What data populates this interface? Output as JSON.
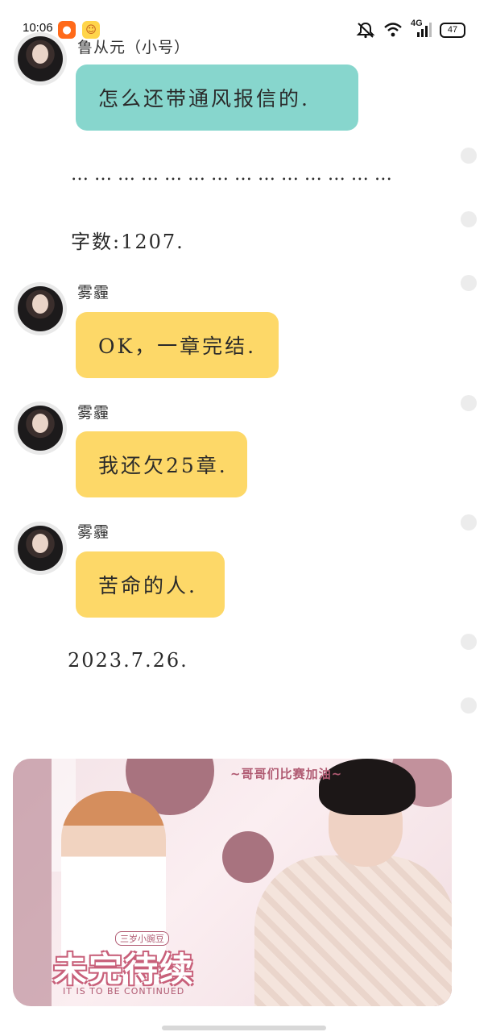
{
  "status_bar": {
    "time": "10:06",
    "network": "4G",
    "battery": "47",
    "icons": [
      "kuaishou-app-icon",
      "emoji-app-icon",
      "mute-icon",
      "wifi-icon",
      "signal-icon",
      "battery-icon"
    ]
  },
  "messages": [
    {
      "sender": "鲁从元（小号）",
      "text": "怎么还带通风报信的.",
      "bubble_color": "#87d6cd"
    },
    {
      "sender": "雾霾",
      "text": "OK，一章完结.",
      "bubble_color": "#fdd868"
    },
    {
      "sender": "雾霾",
      "text": "我还欠25章.",
      "bubble_color": "#fdd868"
    },
    {
      "sender": "雾霾",
      "text": "苦命的人.",
      "bubble_color": "#fdd868"
    }
  ],
  "separator": "… … … … … … … … … … … … … …",
  "word_count": "字数:1207.",
  "date": "2023.7.26.",
  "banner": {
    "tag": "~哥哥们比赛加油~",
    "label": "三岁小豌豆",
    "title": "未完待续",
    "subtitle": "IT IS TO BE CONTINUED"
  }
}
